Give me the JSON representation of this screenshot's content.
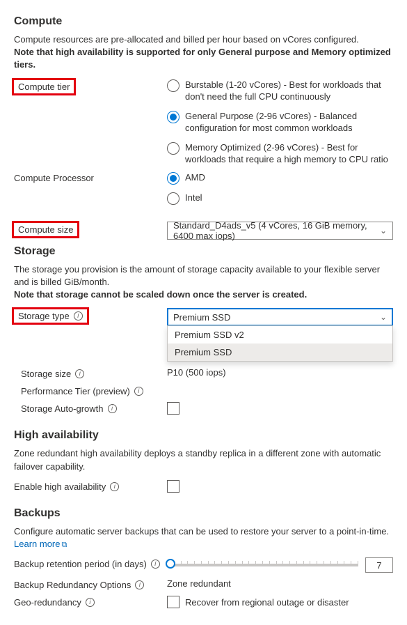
{
  "compute": {
    "title": "Compute",
    "desc_line1": "Compute resources are pre-allocated and billed per hour based on vCores configured.",
    "desc_line2": "Note that high availability is supported for only General purpose and Memory optimized tiers.",
    "tier_label": "Compute tier",
    "tier_options": [
      "Burstable (1-20 vCores) - Best for workloads that don't need the full CPU continuously",
      "General Purpose (2-96 vCores) - Balanced configuration for most common workloads",
      "Memory Optimized (2-96 vCores) - Best for workloads that require a high memory to CPU ratio"
    ],
    "processor_label": "Compute Processor",
    "processor_options": [
      "AMD",
      "Intel"
    ],
    "size_label": "Compute size",
    "size_value": "Standard_D4ads_v5 (4 vCores, 16 GiB memory, 6400 max iops)"
  },
  "storage": {
    "title": "Storage",
    "desc_line1": "The storage you provision is the amount of storage capacity available to your flexible server and is billed GiB/month.",
    "desc_line2": "Note that storage cannot be scaled down once the server is created.",
    "type_label": "Storage type",
    "type_value": "Premium SSD",
    "type_options": [
      "Premium SSD v2",
      "Premium SSD"
    ],
    "size_label": "Storage size",
    "perf_label": "Performance Tier (preview)",
    "perf_value": "P10 (500 iops)",
    "autogrow_label": "Storage Auto-growth"
  },
  "ha": {
    "title": "High availability",
    "desc": "Zone redundant high availability deploys a standby replica in a different zone with automatic failover capability.",
    "enable_label": "Enable high availability"
  },
  "backups": {
    "title": "Backups",
    "desc_prefix": "Configure automatic server backups that can be used to restore your server to a point-in-time. ",
    "learn_more": "Learn more",
    "retention_label": "Backup retention period (in days)",
    "retention_value": "7",
    "redundancy_label": "Backup Redundancy Options",
    "redundancy_value": "Zone redundant",
    "geo_label": "Geo-redundancy",
    "geo_text": "Recover from regional outage or disaster"
  }
}
